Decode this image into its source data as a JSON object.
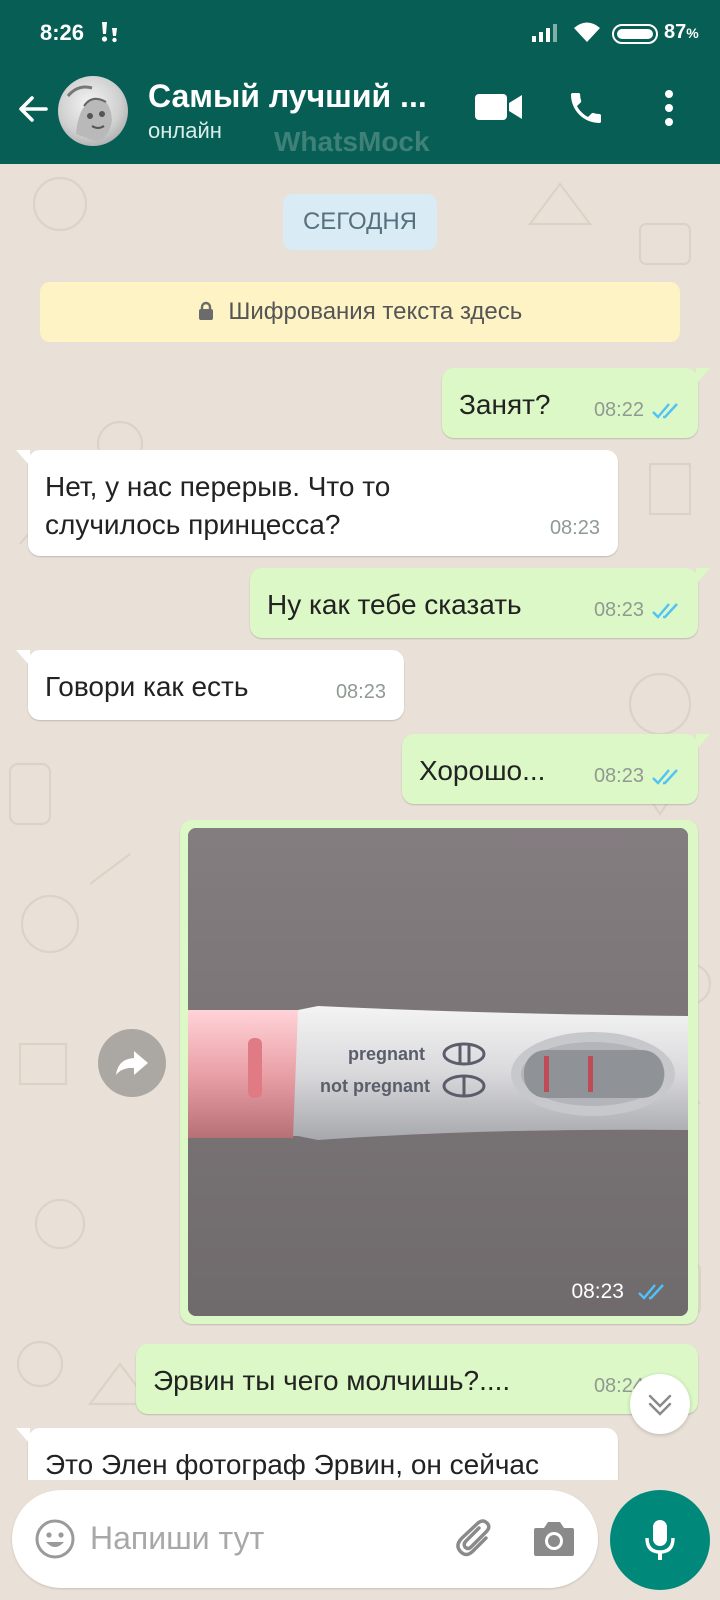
{
  "statusbar": {
    "time": "8:26",
    "battery": "87",
    "battery_unit": "%"
  },
  "header": {
    "contact_name": "Самый лучший ...",
    "contact_status": "онлайн",
    "watermark": "WhatsMock"
  },
  "chat": {
    "date_chip": "СЕГОДНЯ",
    "encryption_notice": "Шифрования текста здесь",
    "messages": [
      {
        "direction": "out",
        "text": "Занят?",
        "time": "08:22",
        "read": true
      },
      {
        "direction": "in",
        "text": "Нет, у нас перерыв. Что то\nслучилось принцесса?",
        "time": "08:23"
      },
      {
        "direction": "out",
        "text": "Ну как тебе сказать",
        "time": "08:23",
        "read": true
      },
      {
        "direction": "in",
        "text": "Говори как есть",
        "time": "08:23"
      },
      {
        "direction": "out",
        "text": "Хорошо...",
        "time": "08:23",
        "read": true
      },
      {
        "direction": "out",
        "type": "image",
        "time": "08:23",
        "read": true,
        "image_labels": {
          "line1": "pregnant",
          "line2": "not pregnant"
        }
      },
      {
        "direction": "out",
        "text": "Эрвин ты чего молчишь?....",
        "time": "08:24",
        "read": true
      },
      {
        "direction": "in",
        "text": "Это Элен фотограф Эрвин, он сейчас"
      }
    ]
  },
  "composer": {
    "placeholder": "Напиши тут"
  },
  "colors": {
    "header": "#075e54",
    "outgoing": "#dcf8c6",
    "incoming": "#ffffff",
    "read_ticks": "#4fc3f7",
    "mic": "#00897b"
  }
}
